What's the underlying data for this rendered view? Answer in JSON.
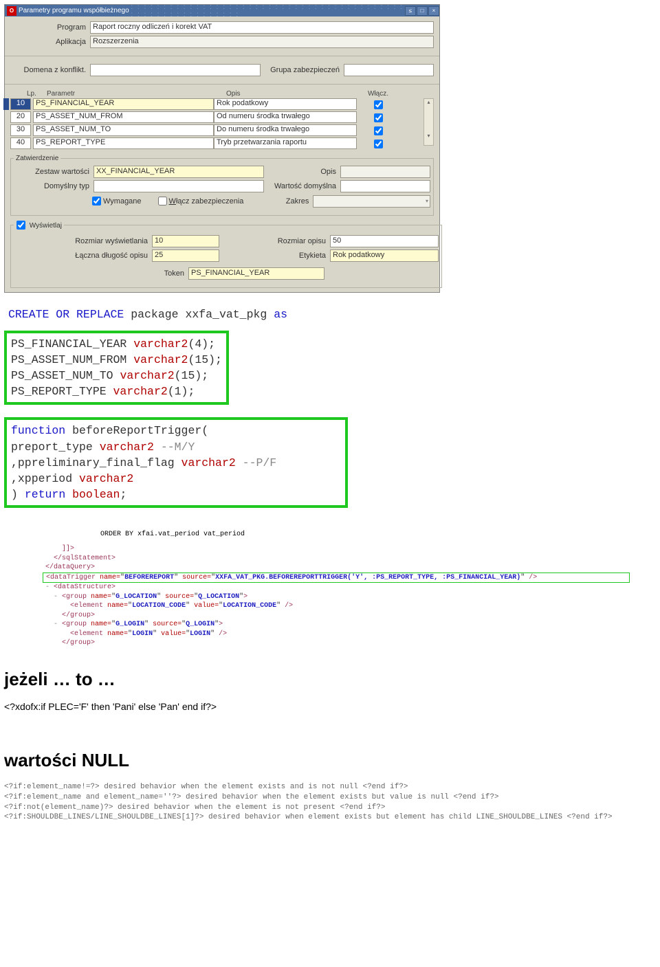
{
  "window": {
    "title": "Parametry programu współbieżnego",
    "btn_min": "≤",
    "btn_max": "□",
    "btn_close": "×"
  },
  "header": {
    "program_lbl": "Program",
    "program_val": "Raport roczny odliczeń i korekt VAT",
    "app_lbl": "Aplikacja",
    "app_val": "Rozszerzenia"
  },
  "conflict": {
    "dom_lbl": "Domena z konflikt.",
    "grp_lbl": "Grupa zabezpieczeń"
  },
  "paramhdr": {
    "lp": "Lp.",
    "param": "Parametr",
    "opis": "Opis",
    "wlacz": "Włącz."
  },
  "params": [
    {
      "lp": "10",
      "name": "PS_FINANCIAL_YEAR",
      "desc": "Rok podatkowy"
    },
    {
      "lp": "20",
      "name": "PS_ASSET_NUM_FROM",
      "desc": "Od numeru środka trwałego"
    },
    {
      "lp": "30",
      "name": "PS_ASSET_NUM_TO",
      "desc": "Do numeru środka trwałego"
    },
    {
      "lp": "40",
      "name": "PS_REPORT_TYPE",
      "desc": "Tryb przetwarzania raportu"
    }
  ],
  "zat": {
    "legend": "Zatwierdzenie",
    "zestaw_lbl": "Zestaw wartości",
    "zestaw_val": "XX_FINANCIAL_YEAR",
    "opis_lbl": "Opis",
    "domtyp_lbl": "Domyślny typ",
    "wart_lbl": "Wartość domyślna",
    "wym": "Wymagane",
    "wlz": "Włącz zabezpieczenia",
    "zakres_lbl": "Zakres"
  },
  "wys": {
    "legend": "Wyświetlaj",
    "rw_lbl": "Rozmiar wyświetlania",
    "rw_val": "10",
    "ro_lbl": "Rozmiar opisu",
    "ro_val": "50",
    "ld_lbl": "Łączna długość opisu",
    "ld_val": "25",
    "et_lbl": "Etykieta",
    "et_val": "Rok podatkowy",
    "tok_lbl": "Token",
    "tok_val": "PS_FINANCIAL_YEAR"
  },
  "code": {
    "l1a": "CREATE OR REPLACE",
    "l1b": " package ",
    "l1c": "xxfa_vat_pkg ",
    "l1d": "as",
    "b1a": "PS_FINANCIAL_YEAR ",
    "b1t": "varchar2",
    "b1p": "(4);",
    "b2a": "PS_ASSET_NUM_FROM ",
    "b2p": "(15);",
    "b3a": "PS_ASSET_NUM_TO ",
    "b3p": "(15);",
    "b4a": "PS_REPORT_TYPE ",
    "b4p": "(1);",
    "f1": "function",
    "f1b": " beforeReportTrigger(",
    "f2a": "  preport_type ",
    "f2c": " --M/Y",
    "f3a": ",ppreliminary_final_flag ",
    "f3c": " --P/F",
    "f4a": ",xpperiod ",
    "f5a": ") ",
    "f5b": "return ",
    "f5c": "boolean",
    "f5d": ";"
  },
  "xml": {
    "orderby": "ORDER BY  xfai.vat_period vat_period",
    "cdata": "]]>",
    "csql": "</sqlStatement>",
    "cdq": "</dataQuery>",
    "dtrig": "<dataTrigger name=\"BEFOREREPORT\" source=\"XXFA_VAT_PKG.BEFOREREPORTTRIGGER('Y', :PS_REPORT_TYPE, :PS_FINANCIAL_YEAR)\" />",
    "ds": "<dataStructure>",
    "g1": "<group name=\"G_LOCATION\" source=\"Q_LOCATION\">",
    "e1": "<element name=\"LOCATION_CODE\" value=\"LOCATION_CODE\" />",
    "cg": "</group>",
    "g2": "<group name=\"G_LOGIN\" source=\"Q_LOGIN\">",
    "e2": "<element name=\"LOGIN\" value=\"LOGIN\" />"
  },
  "sec1": {
    "h": "jeżeli … to …",
    "t": "<?xdofx:if PLEC='F' then 'Pani' else 'Pan' end if?>"
  },
  "sec2": {
    "h": "wartości NULL",
    "l1": "<?if:element_name!=?> desired behavior when the element exists and is not null <?end if?>",
    "l2": "<?if:element_name and element_name=''?> desired behavior when the element exists but value is null <?end if?>",
    "l3": "<?if:not(element_name)?> desired behavior when the element is not present <?end if?>",
    "l4": "<?if:SHOULDBE_LINES/LINE_SHOULDBE_LINES[1]?> desired behavior when element exists but element has child LINE_SHOULDBE_LINES <?end if?>"
  }
}
